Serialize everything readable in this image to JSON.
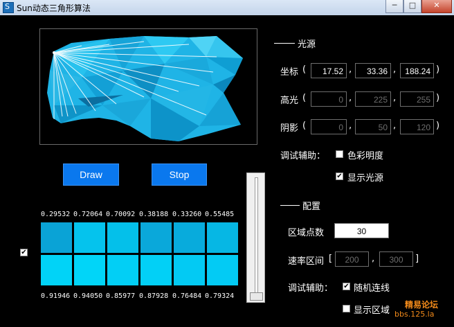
{
  "window": {
    "title": "Sun动态三角形算法",
    "min_label": "─",
    "max_label": "□",
    "close_label": "✕",
    "app_icon_glyph": "S"
  },
  "buttons": {
    "draw": "Draw",
    "stop": "Stop"
  },
  "light_source": {
    "section_title": "光源",
    "coord_label": "坐标",
    "paren_open": "(",
    "paren_close": ")",
    "comma": ",",
    "coords": [
      "17.52",
      "33.36",
      "188.24"
    ],
    "highlight_label": "高光",
    "highlight": [
      "0",
      "225",
      "255"
    ],
    "shadow_label": "阴影",
    "shadow": [
      "0",
      "50",
      "120"
    ],
    "debug_label": "调试辅助：",
    "option_color_brightness": "色彩明度",
    "option_show_light": "显示光源",
    "option_color_brightness_checked": false,
    "option_show_light_checked": true
  },
  "config": {
    "section_title": "配置",
    "region_points_label": "区域点数",
    "region_points": "30",
    "rate_range_label": "速率区间",
    "bracket_open": "[",
    "bracket_close": "]",
    "comma": ",",
    "rate_min": "200",
    "rate_max": "300",
    "debug_label": "调试辅助：",
    "option_random_line": "随机连线",
    "option_show_region": "显示区域",
    "option_random_line_checked": true,
    "option_show_region_checked": false
  },
  "swatches": {
    "checkbox_checked": true,
    "top_values": [
      "0.29532",
      "0.72064",
      "0.70092",
      "0.38188",
      "0.33260",
      "0.55485"
    ],
    "bottom_values": [
      "0.91946",
      "0.94050",
      "0.85977",
      "0.87928",
      "0.76484",
      "0.79324"
    ],
    "top_colors": [
      "#0aa3d6",
      "#05c3ed",
      "#04c0ea",
      "#0aa8da",
      "#08abdc",
      "#06b7e4"
    ],
    "bottom_colors": [
      "#01d3f7",
      "#01d5f8",
      "#02cff5",
      "#02d0f6",
      "#03caf3",
      "#03cbf4"
    ]
  },
  "watermark": {
    "line1": "精易论坛",
    "line2": "bbs.125.la"
  },
  "colors": {
    "accent_blue": "#0a78ee",
    "mesh_blue": "#1fb4e6"
  }
}
